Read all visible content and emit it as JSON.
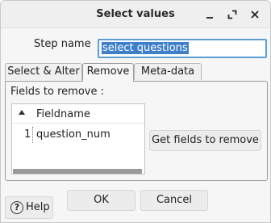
{
  "window": {
    "title": "Select values",
    "controls": [
      "minimize-icon",
      "maximize-icon",
      "close-icon"
    ]
  },
  "step": {
    "label": "Step name",
    "value": "select questions"
  },
  "tabs": [
    {
      "label": "Select & Alter",
      "active": false
    },
    {
      "label": "Remove",
      "active": true
    },
    {
      "label": "Meta-data",
      "active": false
    }
  ],
  "remove_panel": {
    "fields_label": "Fields to remove :",
    "table": {
      "sort_icon": "sort-ascending-icon",
      "header": "Fieldname",
      "rows": [
        {
          "num": "1",
          "fieldname": "question_num"
        }
      ]
    },
    "get_fields_button": "Get fields to remove"
  },
  "footer": {
    "help_label": "Help",
    "ok_label": "OK",
    "cancel_label": "Cancel"
  },
  "colors": {
    "selection": "#3d7fc9",
    "focus_border": "#5a9fd4"
  }
}
